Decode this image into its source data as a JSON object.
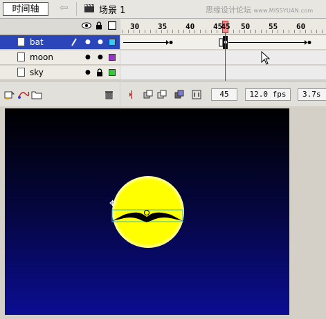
{
  "toolbar": {
    "timeline_label": "时间轴",
    "back_icon": "left-arrow-icon",
    "scene_label": "场景 1",
    "watermark_cn": "思缘设计论坛",
    "watermark_url": "www.MISSYUAN.com"
  },
  "ruler": {
    "labels": [
      "30",
      "35",
      "40",
      "45",
      "50",
      "55",
      "60"
    ],
    "current_frame_marker": "45"
  },
  "layers": [
    {
      "name": "bat",
      "selected": true,
      "color": "#33ccff"
    },
    {
      "name": "moon",
      "selected": false,
      "color": "#9933cc"
    },
    {
      "name": "sky",
      "selected": false,
      "color": "#33cc33"
    }
  ],
  "status": {
    "frame": "45",
    "fps": "12.0 fps",
    "time": "3.7s"
  },
  "colors": {
    "selection": "#2a46b8",
    "playhead": "#d42020",
    "moon": "#ffff00",
    "stage_top": "#000000",
    "stage_bottom": "#0b0d92"
  }
}
